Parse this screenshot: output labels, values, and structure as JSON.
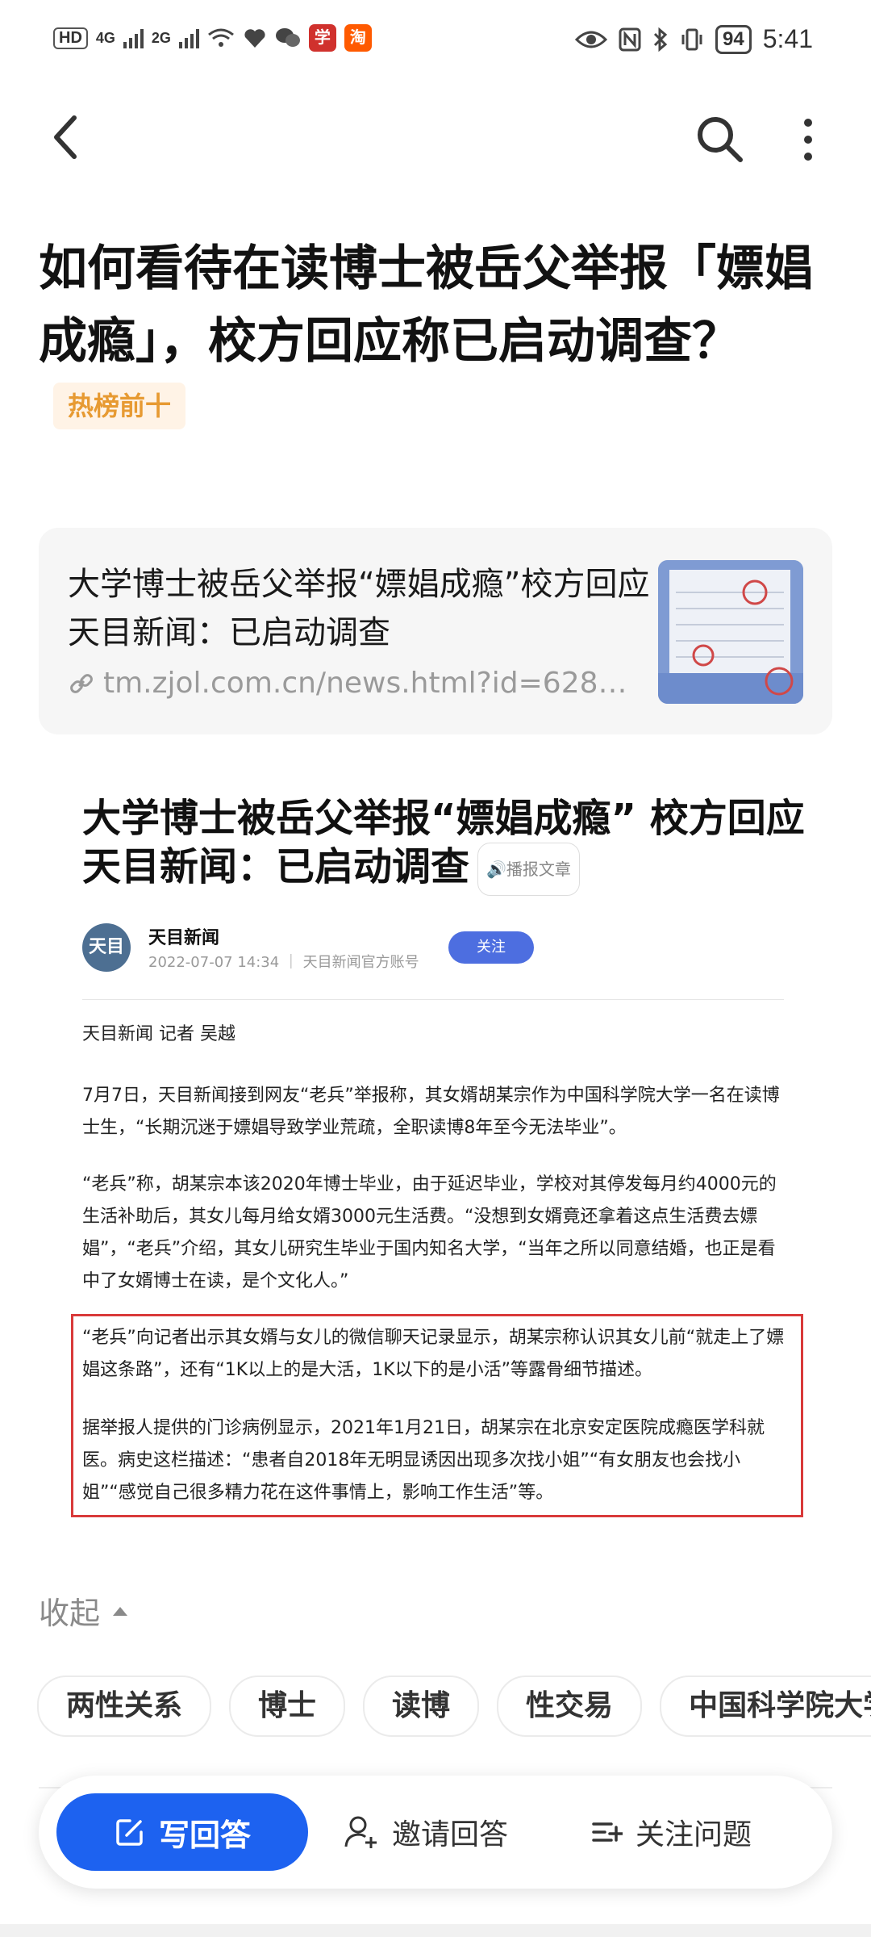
{
  "status_bar": {
    "hd_label": "HD",
    "net1": "4G",
    "net2": "2G",
    "battery": "94",
    "time": "5:41"
  },
  "question": {
    "title": "如何看待在读博士被岳父举报「嫖娼成瘾」，校方回应称已启动调查？",
    "badge": "热榜前十"
  },
  "link_card": {
    "title": "大学博士被岳父举报“嫖娼成瘾”校方回应天目新闻：已启动调查",
    "url": "tm.zjol.com.cn/news.html?id=628…"
  },
  "article_image": {
    "headline": "大学博士被岳父举报“嫖娼成瘾” 校方回应天目新闻：已启动调查",
    "read_aloud": "播报文章",
    "avatar_text": "天目",
    "author": "天目新闻",
    "date": "2022-07-07 14:34",
    "account_type": "天目新闻官方账号",
    "follow": "关注",
    "byline": "天目新闻 记者 吴越",
    "p1": "7月7日，天目新闻接到网友“老兵”举报称，其女婿胡某宗作为中国科学院大学一名在读博士生，“长期沉迷于嫖娼导致学业荒疏，全职读博8年至今无法毕业”。",
    "p2": "“老兵”称，胡某宗本该2020年博士毕业，由于延迟毕业，学校对其停发每月约4000元的生活补助后，其女儿每月给女婿3000元生活费。“没想到女婿竟还拿着这点生活费去嫖娼”，“老兵”介绍，其女儿研究生毕业于国内知名大学，“当年之所以同意结婚，也正是看中了女婿博士在读，是个文化人。”",
    "p3": "“老兵”向记者出示其女婿与女儿的微信聊天记录显示，胡某宗称认识其女儿前“就走上了嫖娼这条路”，还有“1K以上的是大活，1K以下的是小活”等露骨细节描述。",
    "p4": "据举报人提供的门诊病例显示，2021年1月21日，胡某宗在北京安定医院成瘾医学科就医。病史这栏描述：“患者自2018年无明显诱因出现多次找小姐”“有女朋友也会找小姐”“感觉自己很多精力花在这件事情上，影响工作生活”等。"
  },
  "collapse_label": "收起",
  "tags": [
    "两性关系",
    "博士",
    "读博",
    "性交易",
    "中国科学院大学"
  ],
  "bottom_bar": {
    "write": "写回答",
    "invite": "邀请回答",
    "follow": "关注问题"
  },
  "colors": {
    "accent": "#1d62f0",
    "badge_text": "#e79a32",
    "badge_bg": "#fff3e6",
    "highlight_border": "#d93a3a"
  }
}
